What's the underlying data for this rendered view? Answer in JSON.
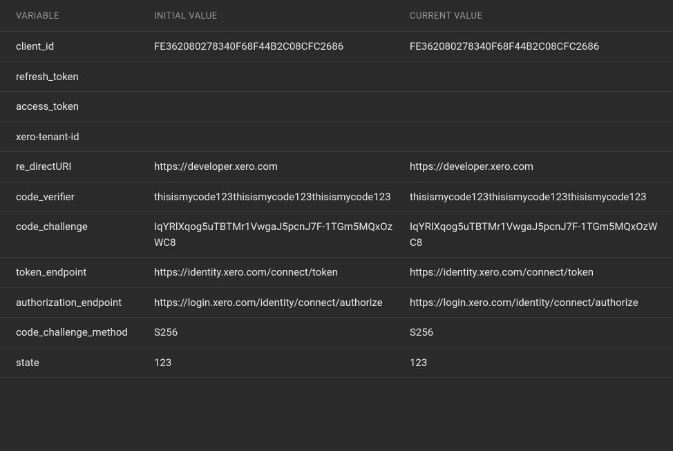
{
  "headers": {
    "variable": "VARIABLE",
    "initial": "INITIAL VALUE",
    "current": "CURRENT VALUE"
  },
  "rows": [
    {
      "variable": "client_id",
      "initial": "FE362080278340F68F44B2C08CFC2686",
      "current": "FE362080278340F68F44B2C08CFC2686"
    },
    {
      "variable": "refresh_token",
      "initial": "",
      "current": ""
    },
    {
      "variable": "access_token",
      "initial": "",
      "current": ""
    },
    {
      "variable": "xero-tenant-id",
      "initial": "",
      "current": ""
    },
    {
      "variable": "re_directURI",
      "initial": "https://developer.xero.com",
      "current": "https://developer.xero.com"
    },
    {
      "variable": "code_verifier",
      "initial": "thisismycode123thisismycode123thisismycode123",
      "current": "thisismycode123thisismycode123thisismycode123"
    },
    {
      "variable": "code_challenge",
      "initial": "IqYRlXqog5uTBTMr1VwgaJ5pcnJ7F-1TGm5MQxOzWC8",
      "current": "IqYRlXqog5uTBTMr1VwgaJ5pcnJ7F-1TGm5MQxOzWC8"
    },
    {
      "variable": "token_endpoint",
      "initial": "https://identity.xero.com/connect/token",
      "current": "https://identity.xero.com/connect/token"
    },
    {
      "variable": "authorization_endpoint",
      "initial": "https://login.xero.com/identity/connect/authorize",
      "current": "https://login.xero.com/identity/connect/authorize"
    },
    {
      "variable": "code_challenge_method",
      "initial": "S256",
      "current": "S256"
    },
    {
      "variable": "state",
      "initial": "123",
      "current": "123"
    }
  ]
}
